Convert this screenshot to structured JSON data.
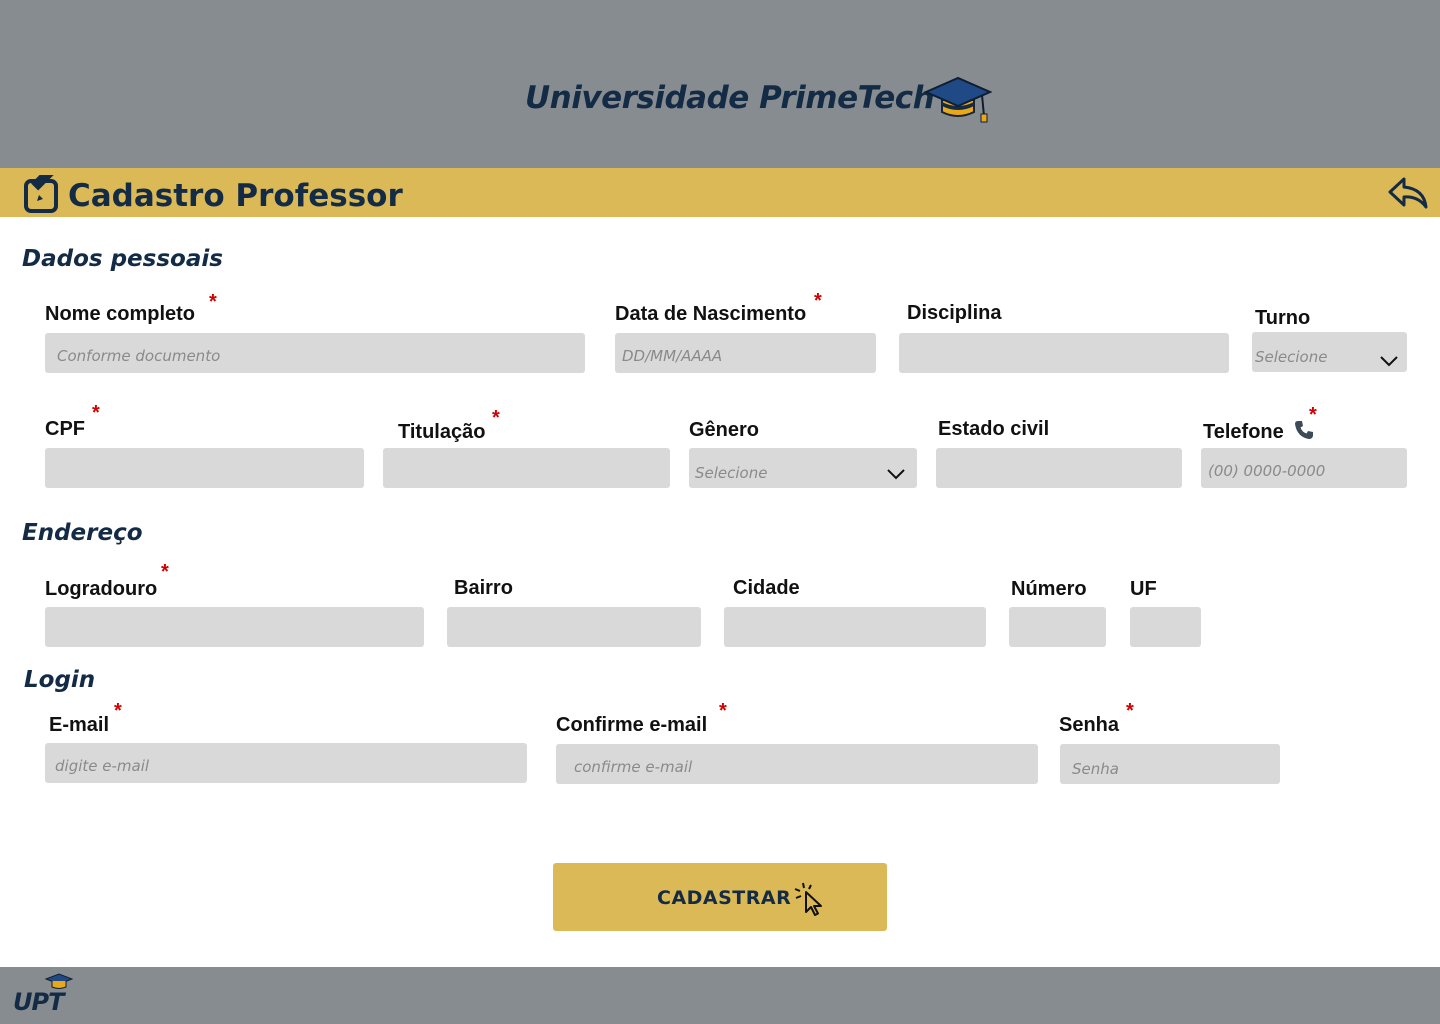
{
  "header": {
    "brand_title": "Universidade PrimeTech"
  },
  "titlebar": {
    "title": "Cadastro Professor"
  },
  "sections": {
    "personal": "Dados pessoais",
    "address": "Endereço",
    "login": "Login"
  },
  "fields": {
    "nome": {
      "label": "Nome completo",
      "placeholder": "Conforme documento",
      "required": true
    },
    "nascimento": {
      "label": "Data de Nascimento",
      "placeholder": "DD/MM/AAAA",
      "required": true
    },
    "disciplina": {
      "label": "Disciplina",
      "placeholder": ""
    },
    "turno": {
      "label": "Turno",
      "selected": "Selecione"
    },
    "cpf": {
      "label": "CPF",
      "placeholder": "",
      "required": true
    },
    "titulacao": {
      "label": "Titulação",
      "placeholder": "",
      "required": true
    },
    "genero": {
      "label": "Gênero",
      "selected": "Selecione"
    },
    "estado_civil": {
      "label": "Estado civil",
      "placeholder": ""
    },
    "telefone": {
      "label": "Telefone",
      "placeholder": "(00) 0000-0000",
      "required": true
    },
    "logradouro": {
      "label": "Logradouro",
      "placeholder": "",
      "required": true
    },
    "bairro": {
      "label": "Bairro",
      "placeholder": ""
    },
    "cidade": {
      "label": "Cidade",
      "placeholder": ""
    },
    "numero": {
      "label": "Número",
      "placeholder": ""
    },
    "uf": {
      "label": "UF",
      "placeholder": ""
    },
    "email": {
      "label": "E-mail",
      "placeholder": "digite e-mail",
      "required": true
    },
    "confirm_email": {
      "label": "Confirme e-mail",
      "placeholder": "confirme e-mail",
      "required": true
    },
    "senha": {
      "label": "Senha",
      "placeholder": "Senha",
      "required": true
    }
  },
  "required_mark": "*",
  "submit": {
    "label": "CADASTRAR"
  },
  "footer": {
    "logo_text": "UPT"
  },
  "icons": {
    "brand": "graduation-cap-icon",
    "title": "edit-icon",
    "back": "reply-arrow-icon",
    "phone": "phone-icon",
    "submit": "cursor-click-icon",
    "dropdown": "chevron-down-icon"
  },
  "colors": {
    "header_bg": "#878c91",
    "accent_gold": "#dbb957",
    "navy": "#142b45",
    "field_bg": "#d9d9d9",
    "required_red": "#d10000"
  }
}
